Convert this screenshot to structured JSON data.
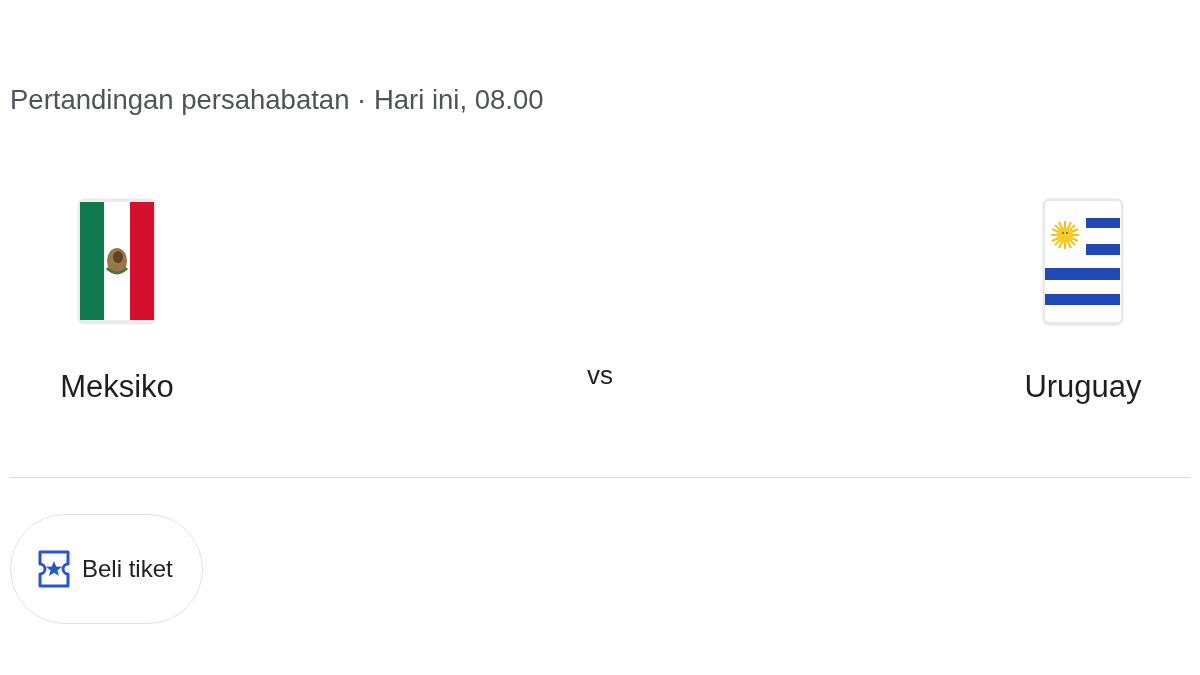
{
  "header": {
    "text": "Pertandingan persahabatan · Hari ini, 08.00"
  },
  "teams": [
    {
      "name": "Meksiko",
      "kind": "mexico"
    },
    {
      "name": "Uruguay",
      "kind": "uruguay"
    }
  ],
  "versus": "vs",
  "actions": [
    {
      "label": "Beli tiket",
      "kind": "ticket"
    }
  ]
}
